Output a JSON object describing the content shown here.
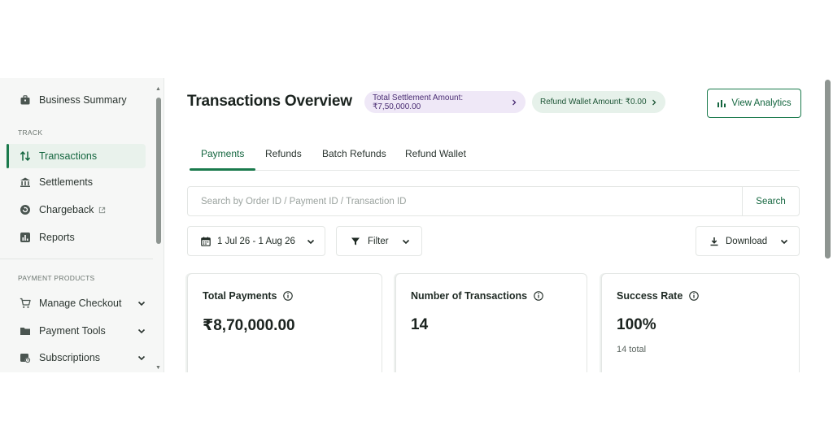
{
  "sidebar": {
    "top_item": {
      "label": "Business Summary",
      "icon": "briefcase-icon"
    },
    "track_section": "TRACK",
    "track_items": [
      {
        "label": "Transactions",
        "icon": "arrows-up-down-icon",
        "active": true
      },
      {
        "label": "Settlements",
        "icon": "bank-icon"
      },
      {
        "label": "Chargeback",
        "icon": "chargeback-icon",
        "external": true
      },
      {
        "label": "Reports",
        "icon": "report-chart-icon"
      }
    ],
    "products_section": "PAYMENT PRODUCTS",
    "product_items": [
      {
        "label": "Manage Checkout",
        "icon": "cart-icon"
      },
      {
        "label": "Payment Tools",
        "icon": "folder-icon"
      },
      {
        "label": "Subscriptions",
        "icon": "calendar-clock-icon"
      }
    ]
  },
  "header": {
    "title": "Transactions Overview",
    "settlement_pill": "Total Settlement Amount: ₹7,50,000.00",
    "refund_pill": "Refund Wallet Amount: ₹0.00",
    "analytics_button": "View Analytics"
  },
  "tabs": [
    {
      "label": "Payments",
      "active": true
    },
    {
      "label": "Refunds"
    },
    {
      "label": "Batch Refunds"
    },
    {
      "label": "Refund Wallet"
    }
  ],
  "search": {
    "placeholder": "Search by Order ID / Payment ID / Transaction ID",
    "value": "",
    "button": "Search"
  },
  "filters": {
    "date_range": "1 Jul 26 - 1 Aug 26",
    "filter_label": "Filter",
    "download_label": "Download"
  },
  "cards": [
    {
      "title": "Total Payments",
      "value": "₹8,70,000.00",
      "sub": ""
    },
    {
      "title": "Number of Transactions",
      "value": "14",
      "sub": ""
    },
    {
      "title": "Success Rate",
      "value": "100%",
      "sub": "14 total"
    }
  ],
  "colors": {
    "brand_green": "#1a7a4c",
    "active_bg": "#e9f2ec",
    "settlement_pill_bg": "#efe8f7",
    "refund_pill_bg": "#e6f1ea"
  }
}
